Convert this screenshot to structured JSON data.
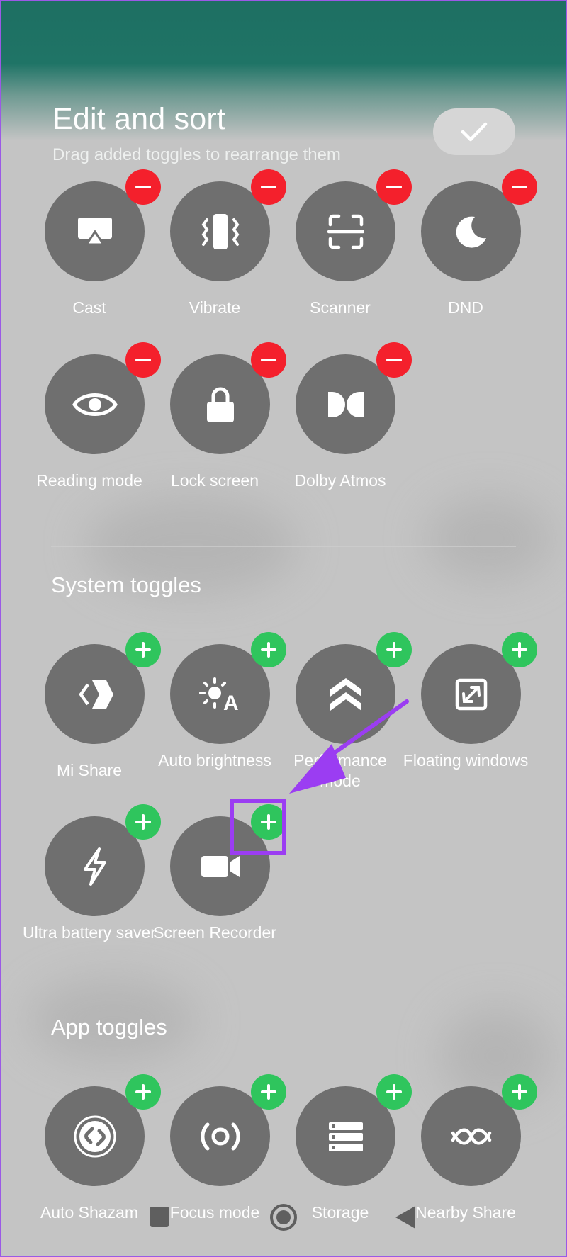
{
  "header": {
    "title": "Edit and sort",
    "subtitle": "Drag added toggles to rearrange them",
    "done_icon": "check-icon"
  },
  "added_toggles": [
    {
      "label": "Cast",
      "icon": "cast-icon"
    },
    {
      "label": "Vibrate",
      "icon": "vibrate-icon"
    },
    {
      "label": "Scanner",
      "icon": "scanner-icon"
    },
    {
      "label": "DND",
      "icon": "moon-icon"
    },
    {
      "label": "Reading mode",
      "icon": "eye-icon"
    },
    {
      "label": "Lock screen",
      "icon": "lock-icon"
    },
    {
      "label": "Dolby Atmos",
      "icon": "dolby-icon"
    }
  ],
  "system_toggles": {
    "title": "System toggles",
    "items": [
      {
        "label": "Mi Share",
        "icon": "mi-share-icon"
      },
      {
        "label": "Auto brightness",
        "icon": "auto-brightness-icon"
      },
      {
        "label": "Performance mode",
        "icon": "performance-icon"
      },
      {
        "label": "Floating windows",
        "icon": "floating-window-icon"
      },
      {
        "label": "Ultra battery saver",
        "icon": "lightning-icon"
      },
      {
        "label": "Screen Recorder",
        "icon": "video-camera-icon"
      }
    ]
  },
  "app_toggles": {
    "title": "App toggles",
    "items": [
      {
        "label": "Auto Shazam",
        "icon": "shazam-icon"
      },
      {
        "label": "Focus mode",
        "icon": "focus-icon"
      },
      {
        "label": "Storage",
        "icon": "storage-icon"
      },
      {
        "label": "Nearby Share",
        "icon": "nearby-share-icon"
      }
    ]
  },
  "colors": {
    "remove_badge": "#f4202c",
    "add_badge": "#2fc55d",
    "annotation": "#9b3df2",
    "tile": "#6f6f6f"
  }
}
